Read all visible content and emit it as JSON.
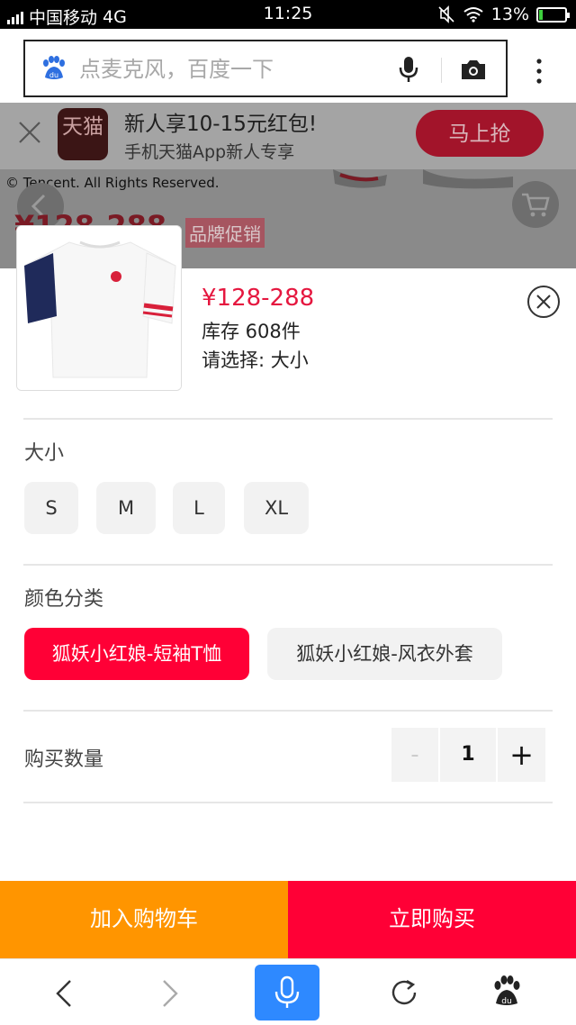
{
  "status_bar": {
    "carrier": "中国移动",
    "network": "4G",
    "time": "11:25",
    "battery": "13%",
    "battery_level": 0.13
  },
  "search": {
    "placeholder": "点麦克风，百度一下"
  },
  "banner": {
    "app_icon_text": "天猫",
    "title": "新人享10-15元红包!",
    "subtitle": "手机天猫App新人专享",
    "cta": "马上抢"
  },
  "backdrop": {
    "copyright": "© Tencent. All Rights Reserved.",
    "price": "¥128-288",
    "promo": "品牌促销"
  },
  "product": {
    "price": "¥128-288",
    "stock": "库存 608件",
    "select_hint": "请选择: 大小"
  },
  "size": {
    "label": "大小",
    "options": [
      "S",
      "M",
      "L",
      "XL"
    ]
  },
  "color": {
    "label": "颜色分类",
    "options": [
      "狐妖小红娘-短袖T恤",
      "狐妖小红娘-风衣外套"
    ],
    "selected_index": 0
  },
  "quantity": {
    "label": "购买数量",
    "minus": "-",
    "value": "1",
    "plus": "+"
  },
  "actions": {
    "add_to_cart": "加入购物车",
    "buy_now": "立即购买"
  },
  "colors": {
    "accent": "#ff0036",
    "cart": "#ff9500",
    "price": "#e5173f",
    "voice": "#2e89ff"
  }
}
